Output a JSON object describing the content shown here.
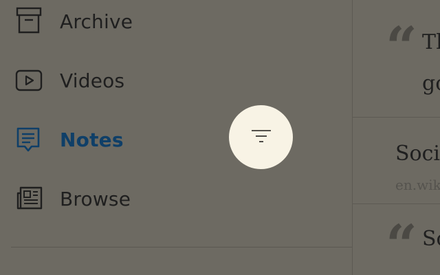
{
  "nav": {
    "items": [
      {
        "label": "Archive",
        "icon": "archive-icon",
        "active": false
      },
      {
        "label": "Videos",
        "icon": "video-icon",
        "active": false
      },
      {
        "label": "Notes",
        "icon": "notes-icon",
        "active": true
      },
      {
        "label": "Browse",
        "icon": "newspaper-icon",
        "active": false
      }
    ],
    "active_color": "#0f3f68"
  },
  "content": {
    "quote1": {
      "line1": "Th",
      "line2": "go"
    },
    "card": {
      "title": "Soci",
      "source": "en.wik"
    },
    "quote2": {
      "line1": "So"
    }
  },
  "fab": {
    "icon": "filter-icon"
  }
}
